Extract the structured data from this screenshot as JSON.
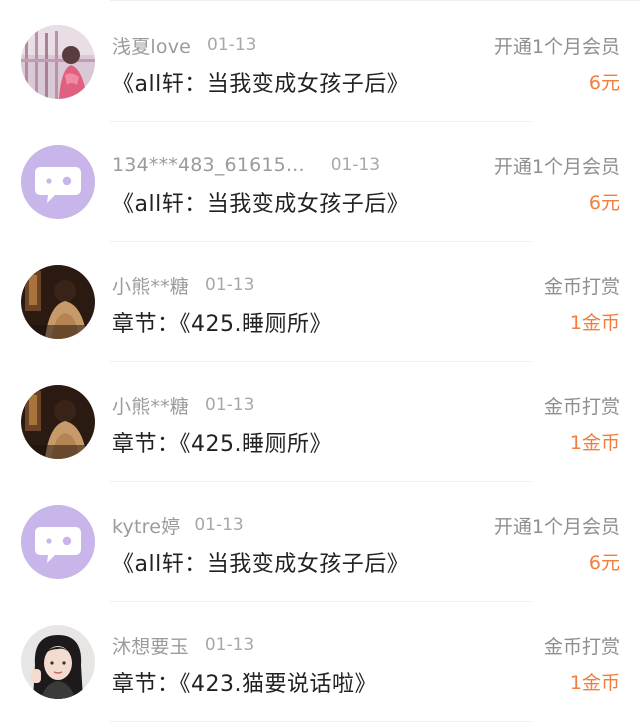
{
  "colors": {
    "amount_accent": "#f47d3b",
    "secondary_text": "#9b9b9b",
    "primary_text": "#222222",
    "default_avatar_bg": "#c8b5ea"
  },
  "items": [
    {
      "user": "浅夏love",
      "date": "01-13",
      "type": "开通1个月会员",
      "title": "《all轩：当我变成女孩子后》",
      "amount": "6元",
      "avatar_icon": "user-photo-pink-icon"
    },
    {
      "user": "134***483_61615...",
      "date": "01-13",
      "type": "开通1个月会员",
      "title": "《all轩：当我变成女孩子后》",
      "amount": "6元",
      "avatar_icon": "default-chat-bubble-avatar-icon"
    },
    {
      "user": "小熊**糖",
      "date": "01-13",
      "type": "金币打赏",
      "title": "章节：《425.睡厕所》",
      "amount": "1金币",
      "avatar_icon": "user-photo-dark-icon"
    },
    {
      "user": "小熊**糖",
      "date": "01-13",
      "type": "金币打赏",
      "title": "章节：《425.睡厕所》",
      "amount": "1金币",
      "avatar_icon": "user-photo-dark-icon"
    },
    {
      "user": "kytre婷",
      "date": "01-13",
      "type": "开通1个月会员",
      "title": "《all轩：当我变成女孩子后》",
      "amount": "6元",
      "avatar_icon": "default-chat-bubble-avatar-icon"
    },
    {
      "user": "沐想要玉",
      "date": "01-13",
      "type": "金币打赏",
      "title": "章节：《423.猫要说话啦》",
      "amount": "1金币",
      "avatar_icon": "user-photo-portrait-icon"
    }
  ]
}
